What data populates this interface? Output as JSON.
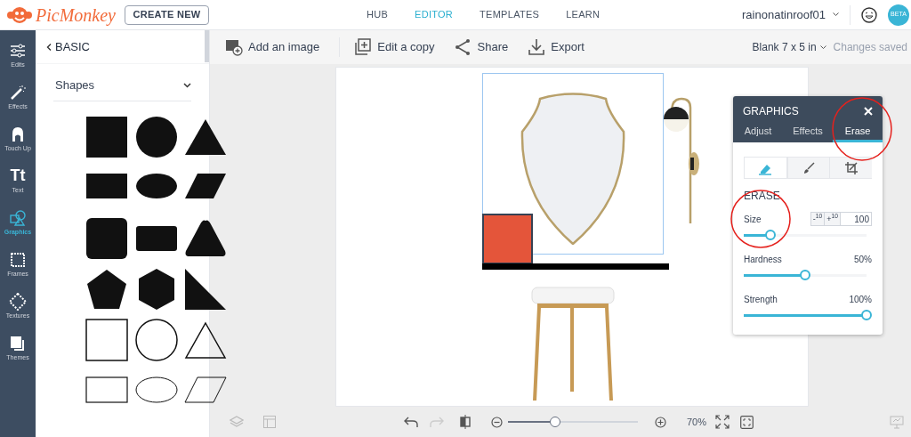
{
  "header": {
    "logo": "PicMonkey",
    "create_button": "CREATE NEW",
    "nav": [
      {
        "label": "HUB",
        "selected": false
      },
      {
        "label": "EDITOR",
        "selected": true
      },
      {
        "label": "TEMPLATES",
        "selected": false
      },
      {
        "label": "LEARN",
        "selected": false
      }
    ],
    "user": "rainonatinroof01",
    "badge": "BETA"
  },
  "rail": [
    {
      "label": "Edits",
      "selected": false
    },
    {
      "label": "Effects",
      "selected": false
    },
    {
      "label": "Touch Up",
      "selected": false
    },
    {
      "label": "Text",
      "selected": false,
      "glyph": "Tt"
    },
    {
      "label": "Graphics",
      "selected": true
    },
    {
      "label": "Frames",
      "selected": false
    },
    {
      "label": "Textures",
      "selected": false
    },
    {
      "label": "Themes",
      "selected": false
    }
  ],
  "panel": {
    "back": "BASIC",
    "section": "Shapes"
  },
  "toolbar": {
    "actions": [
      "Add an image",
      "Edit a copy",
      "Share",
      "Export"
    ],
    "document": "Blank 7 x 5 in",
    "status": "Changes saved"
  },
  "graphics_panel": {
    "title": "GRAPHICS",
    "tabs": [
      {
        "label": "Adjust",
        "selected": false
      },
      {
        "label": "Effects",
        "selected": false
      },
      {
        "label": "Erase",
        "selected": true
      }
    ],
    "tools": [
      {
        "kind": "eraser",
        "selected": true
      },
      {
        "kind": "brush",
        "selected": false
      },
      {
        "kind": "crop",
        "selected": false
      }
    ],
    "section": "ERASE",
    "sliders": [
      {
        "label": "Size",
        "kind": "stepper",
        "level": 0.22,
        "steps": [
          "-$^{10}$",
          "+$^{10}$"
        ],
        "value": "100"
      },
      {
        "label": "Hardness",
        "kind": "reading",
        "level": 0.5,
        "reading": "50%"
      },
      {
        "label": "Strength",
        "kind": "reading",
        "level": 1,
        "reading": "100%"
      }
    ]
  },
  "zoom": {
    "level": 0.36,
    "reading": "70%"
  }
}
